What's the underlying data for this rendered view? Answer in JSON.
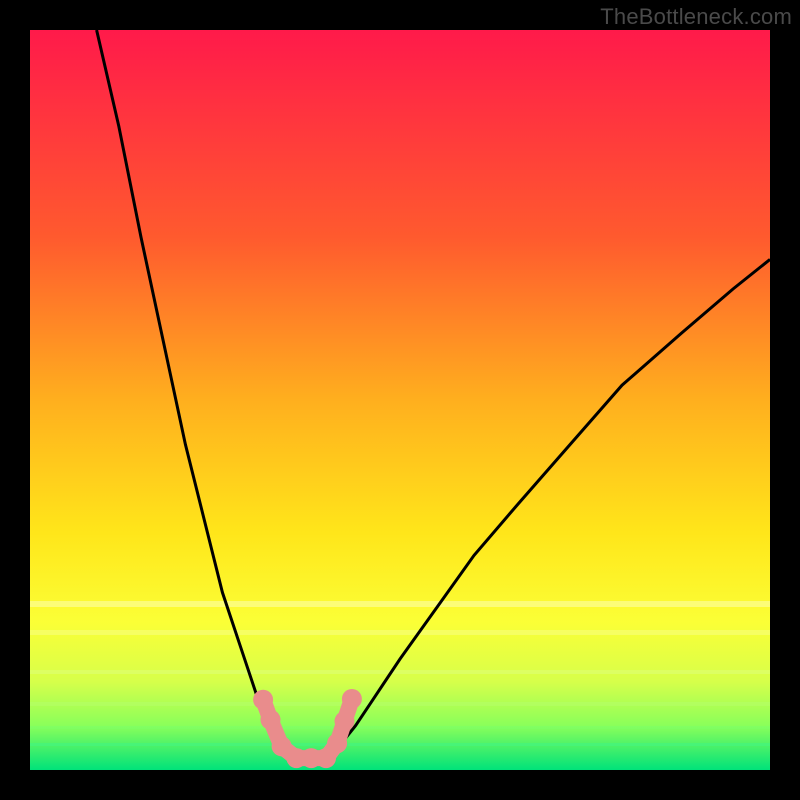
{
  "watermark": "TheBottleneck.com",
  "chart_data": {
    "type": "line",
    "title": "",
    "xlabel": "",
    "ylabel": "",
    "xlim": [
      0,
      100
    ],
    "ylim": [
      0,
      100
    ],
    "grid": false,
    "series": [
      {
        "name": "left-curve",
        "x": [
          9,
          12,
          15,
          18,
          21,
          24,
          26,
          28,
          30,
          31,
          32,
          33,
          34,
          35,
          36
        ],
        "y": [
          100,
          87,
          72,
          58,
          44,
          32,
          24,
          18,
          12,
          9,
          7,
          5,
          3.5,
          2.2,
          1.5
        ]
      },
      {
        "name": "right-curve",
        "x": [
          40,
          41,
          42,
          44,
          46,
          50,
          55,
          60,
          66,
          73,
          80,
          88,
          95,
          100
        ],
        "y": [
          1.5,
          2.2,
          3.5,
          6,
          9,
          15,
          22,
          29,
          36,
          44,
          52,
          59,
          65,
          69
        ]
      },
      {
        "name": "data-points",
        "x": [
          31.5,
          32.5,
          34,
          36,
          38,
          40,
          41.5,
          42.5,
          43.5
        ],
        "y": [
          9.5,
          6.8,
          3.2,
          1.6,
          1.6,
          1.6,
          3.6,
          6.6,
          9.6
        ]
      }
    ],
    "gradient_bands": [
      {
        "color": "#ff1a4a",
        "stop": 0
      },
      {
        "color": "#ff5a2e",
        "stop": 28
      },
      {
        "color": "#ffaf1e",
        "stop": 50
      },
      {
        "color": "#ffe61a",
        "stop": 68
      },
      {
        "color": "#fbff36",
        "stop": 80
      },
      {
        "color": "#d7ff4a",
        "stop": 88
      },
      {
        "color": "#8aff5a",
        "stop": 94
      },
      {
        "color": "#00e27a",
        "stop": 100
      }
    ],
    "point_color": "#e98c8c",
    "curve_color": "#000000"
  }
}
